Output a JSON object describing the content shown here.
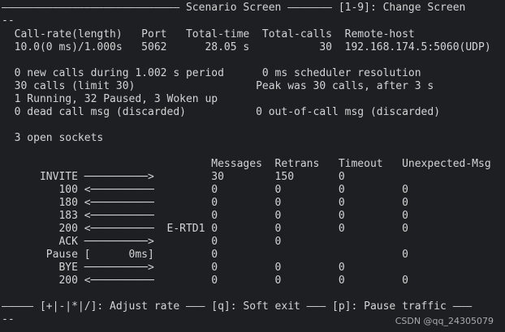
{
  "terminal": {
    "header_line": "———————————————————————————— Scenario Screen ——————— [1-9]: Change Screen",
    "header_continuation": "--",
    "call_rate_header": "  Call-rate(length)   Port   Total-time  Total-calls  Remote-host",
    "call_rate_values": "  10.0(0 ms)/1.000s   5062      28.05 s           30  192.168.174.5:5060(UDP)",
    "stats_line_1": "  0 new calls during 1.002 s period      0 ms scheduler resolution",
    "stats_line_2": "  30 calls (limit 30)                   Peak was 30 calls, after 3 s",
    "stats_line_3": "  1 Running, 32 Paused, 3 Woken up",
    "stats_line_4": "  0 dead call msg (discarded)           0 out-of-call msg (discarded)",
    "stats_line_5": "  3 open sockets",
    "messages_header": "                                 Messages  Retrans   Timeout   Unexpected-Msg",
    "messages_rows": [
      "      INVITE ──────────>         30        150       0",
      "         100 <──────────         0         0         0         0",
      "         180 <──────────         0         0         0         0",
      "         183 <──────────         0         0         0         0",
      "         200 <──────────  E-RTD1 0         0         0         0",
      "         ACK ──────────>         0         0",
      "       Pause [      0ms]         0                             0",
      "         BYE ──────────>         0         0         0",
      "         200 <──────────         0         0         0         0"
    ],
    "footer_line": "————— [+|-|*|/]: Adjust rate ——— [q]: Soft exit ——— [p]: Pause traffic ———",
    "footer_continuation": "--"
  },
  "watermark": "CSDN @qq_24305079"
}
